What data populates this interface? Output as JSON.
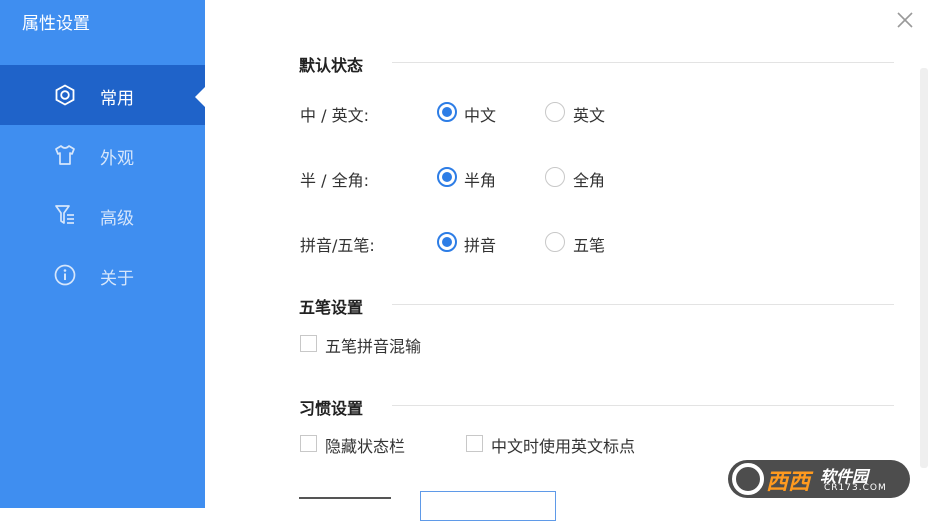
{
  "sidebar": {
    "title": "属性设置",
    "items": [
      {
        "label": "常用",
        "icon": "gear-icon",
        "active": true
      },
      {
        "label": "外观",
        "icon": "shirt-icon",
        "active": false
      },
      {
        "label": "高级",
        "icon": "filter-icon",
        "active": false
      },
      {
        "label": "关于",
        "icon": "info-icon",
        "active": false
      }
    ]
  },
  "window": {
    "close_icon": "close-icon"
  },
  "sections": {
    "default_state": {
      "title": "默认状态",
      "rows": [
        {
          "label": "中 / 英文:",
          "options": [
            "中文",
            "英文"
          ],
          "selected": "中文"
        },
        {
          "label": "半 / 全角:",
          "options": [
            "半角",
            "全角"
          ],
          "selected": "半角"
        },
        {
          "label": "拼音/五笔:",
          "options": [
            "拼音",
            "五笔"
          ],
          "selected": "拼音"
        }
      ]
    },
    "wubi": {
      "title": "五笔设置",
      "checkboxes": [
        {
          "label": "五笔拼音混输",
          "checked": false
        }
      ]
    },
    "habit": {
      "title": "习惯设置",
      "checkboxes": [
        {
          "label": "隐藏状态栏",
          "checked": false
        },
        {
          "label": "中文时使用英文标点",
          "checked": false
        }
      ]
    }
  },
  "watermark": {
    "brand": "西西",
    "name": "软件园",
    "url": "CR173.COM"
  },
  "colors": {
    "sidebar": "#3f8ef0",
    "sidebar_active": "#1f63c9",
    "accent": "#2d7de6"
  }
}
